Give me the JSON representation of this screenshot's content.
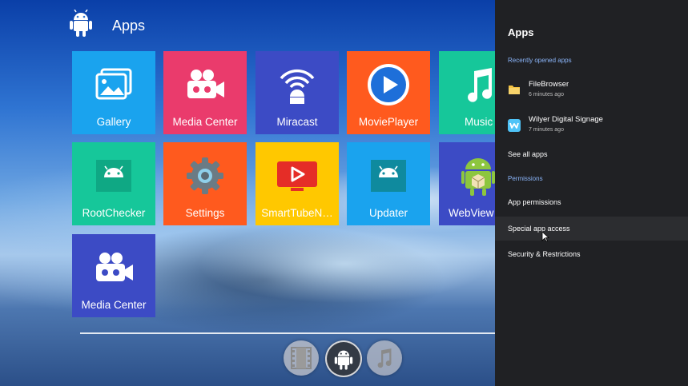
{
  "launcher": {
    "title": "Apps",
    "header_icon": "android-icon",
    "tiles": [
      {
        "label": "Gallery",
        "icon": "gallery-icon",
        "color": "#1aa3ee"
      },
      {
        "label": "Media Center",
        "icon": "video-camera-icon",
        "color": "#ea3b6c"
      },
      {
        "label": "Miracast",
        "icon": "miracast-icon",
        "color": "#3c4bc5"
      },
      {
        "label": "MoviePlayer",
        "icon": "play-circle-icon",
        "color": "#ff5a1e"
      },
      {
        "label": "Music",
        "icon": "music-note-icon",
        "color": "#16c79a"
      },
      {
        "label": "RootChecker",
        "icon": "android-icon",
        "color": "#16c79a"
      },
      {
        "label": "Settings",
        "icon": "gear-icon",
        "color": "#ff5a1e"
      },
      {
        "label": "SmartTubeN…",
        "icon": "tv-play-icon",
        "color": "#ffc800"
      },
      {
        "label": "Updater",
        "icon": "android-icon",
        "color": "#1aa3ee"
      },
      {
        "label": "WebView",
        "icon": "android-box-icon",
        "color": "#3c4bc5"
      },
      {
        "label": "Media Center",
        "icon": "video-camera-icon",
        "color": "#3c4bc5"
      }
    ],
    "dock": [
      {
        "icon": "film-icon"
      },
      {
        "icon": "android-icon"
      },
      {
        "icon": "music-note-icon"
      }
    ]
  },
  "panel": {
    "title": "Apps",
    "recent_section": "Recently opened apps",
    "recent_apps": [
      {
        "name": "FileBrowser",
        "time": "6 minutes ago",
        "icon": "folder-icon",
        "color": "#f4c342"
      },
      {
        "name": "Wilyer Digital Signage",
        "time": "7 minutes ago",
        "icon": "wilyer-icon",
        "color": "#4fc3f7"
      }
    ],
    "see_all": "See all apps",
    "permissions_section": "Permissions",
    "permission_items": [
      "App permissions",
      "Special app access",
      "Security & Restrictions"
    ]
  }
}
